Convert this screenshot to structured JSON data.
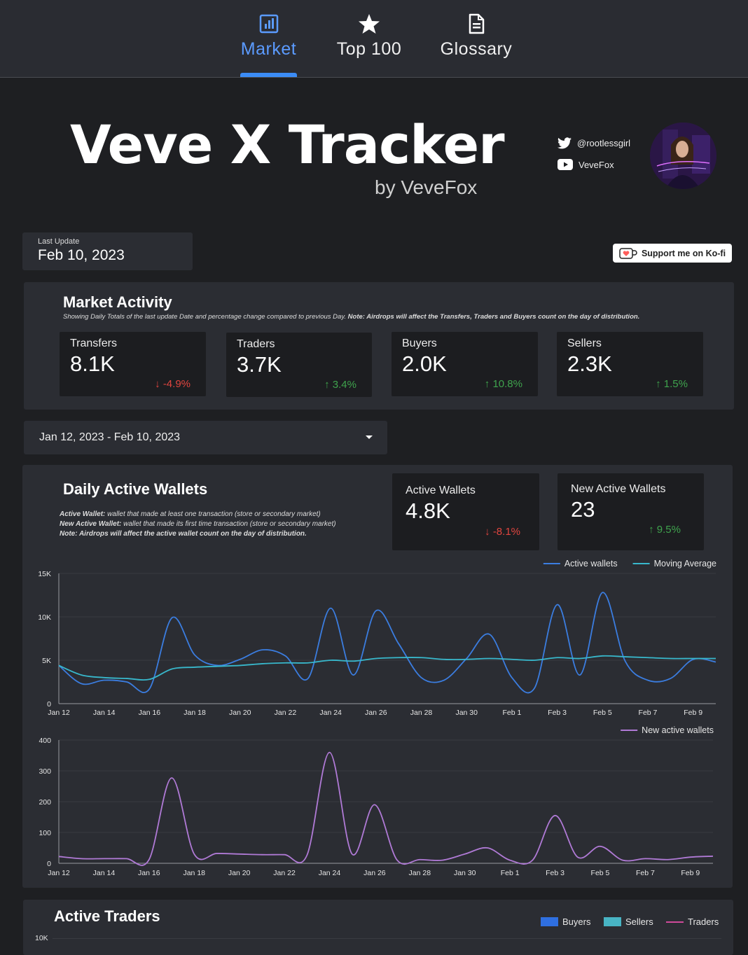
{
  "nav": {
    "tabs": [
      {
        "label": "Market"
      },
      {
        "label": "Top 100"
      },
      {
        "label": "Glossary"
      }
    ]
  },
  "header": {
    "title": "Veve X Tracker",
    "byline": "by VeveFox",
    "twitter": "@rootlessgirl",
    "youtube": "VeveFox"
  },
  "last_update": {
    "label": "Last Update",
    "value": "Feb 10, 2023"
  },
  "kofi": {
    "label": "Support me on Ko-fi"
  },
  "market_activity": {
    "title": "Market Activity",
    "subtitle": "Showing Daily Totals of the last update Date and percentage change compared to previous Day.",
    "note": "Note: Airdrops will affect the Transfers, Traders and Buyers count on the day of distribution.",
    "cards": [
      {
        "label": "Transfers",
        "value": "8.1K",
        "delta": "-4.9%",
        "trend": "down"
      },
      {
        "label": "Traders",
        "value": "3.7K",
        "delta": "3.4%",
        "trend": "up"
      },
      {
        "label": "Buyers",
        "value": "2.0K",
        "delta": "10.8%",
        "trend": "up"
      },
      {
        "label": "Sellers",
        "value": "2.3K",
        "delta": "1.5%",
        "trend": "up"
      }
    ]
  },
  "date_range": {
    "value": "Jan 12, 2023 - Feb 10, 2023"
  },
  "daily_active_wallets": {
    "title": "Daily Active Wallets",
    "def1_term": "Active Wallet:",
    "def1_text": " wallet that made at least one transaction (store or secondary market)",
    "def2_term": "New Active Wallet:",
    "def2_text": " wallet that made its first time transaction (store or secondary market)",
    "note": "Note: Airdrops will affect the active wallet count on the day of distribution.",
    "cards": [
      {
        "label": "Active Wallets",
        "value": "4.8K",
        "delta": "-8.1%",
        "trend": "down"
      },
      {
        "label": "New Active Wallets",
        "value": "23",
        "delta": "9.5%",
        "trend": "up"
      }
    ]
  },
  "active_traders": {
    "title": "Active Traders",
    "legend": [
      "Buyers",
      "Sellers",
      "Traders"
    ],
    "y_top_tick": "10K"
  },
  "colors": {
    "accent": "#3b8cf6",
    "active": "#3b7de0",
    "moving": "#38b8cc",
    "new": "#b07ad6",
    "buyers": "#2f6fe0",
    "sellers": "#48b4c4",
    "traders": "#d04a9a"
  },
  "chart_data": [
    {
      "type": "line",
      "x": [
        "Jan 12",
        "Jan 13",
        "Jan 14",
        "Jan 15",
        "Jan 16",
        "Jan 17",
        "Jan 18",
        "Jan 19",
        "Jan 20",
        "Jan 21",
        "Jan 22",
        "Jan 23",
        "Jan 24",
        "Jan 25",
        "Jan 26",
        "Jan 27",
        "Jan 28",
        "Jan 29",
        "Jan 30",
        "Jan 31",
        "Feb 1",
        "Feb 2",
        "Feb 3",
        "Feb 4",
        "Feb 5",
        "Feb 6",
        "Feb 7",
        "Feb 8",
        "Feb 9",
        "Feb 10"
      ],
      "x_ticks": [
        "Jan 12",
        "Jan 14",
        "Jan 16",
        "Jan 18",
        "Jan 20",
        "Jan 22",
        "Jan 24",
        "Jan 26",
        "Jan 28",
        "Jan 30",
        "Feb 1",
        "Feb 3",
        "Feb 5",
        "Feb 7",
        "Feb 9"
      ],
      "y_ticks": [
        "0",
        "5K",
        "10K",
        "15K"
      ],
      "ylim": [
        0,
        15000
      ],
      "legend_position": "top-right",
      "series": [
        {
          "name": "Active wallets",
          "values": [
            4400,
            2300,
            2700,
            2500,
            1700,
            9900,
            5600,
            4400,
            5100,
            6200,
            5500,
            2900,
            11000,
            3300,
            10700,
            6900,
            3000,
            2700,
            5200,
            8000,
            3000,
            1800,
            11400,
            3300,
            12800,
            4900,
            2700,
            2900,
            5100,
            4800
          ]
        },
        {
          "name": "Moving Average",
          "values": [
            4400,
            3300,
            3000,
            2900,
            2800,
            4000,
            4200,
            4300,
            4400,
            4600,
            4700,
            4700,
            5000,
            4900,
            5200,
            5300,
            5300,
            5100,
            5100,
            5200,
            5100,
            5000,
            5300,
            5200,
            5500,
            5400,
            5300,
            5200,
            5200,
            5200
          ]
        }
      ]
    },
    {
      "type": "line",
      "x": [
        "Jan 12",
        "Jan 13",
        "Jan 14",
        "Jan 15",
        "Jan 16",
        "Jan 17",
        "Jan 18",
        "Jan 19",
        "Jan 20",
        "Jan 21",
        "Jan 22",
        "Jan 23",
        "Jan 24",
        "Jan 25",
        "Jan 26",
        "Jan 27",
        "Jan 28",
        "Jan 29",
        "Jan 30",
        "Jan 31",
        "Feb 1",
        "Feb 2",
        "Feb 3",
        "Feb 4",
        "Feb 5",
        "Feb 6",
        "Feb 7",
        "Feb 8",
        "Feb 9",
        "Feb 10"
      ],
      "x_ticks": [
        "Jan 12",
        "Jan 14",
        "Jan 16",
        "Jan 18",
        "Jan 20",
        "Jan 22",
        "Jan 24",
        "Jan 26",
        "Jan 28",
        "Jan 30",
        "Feb 1",
        "Feb 3",
        "Feb 5",
        "Feb 7",
        "Feb 9"
      ],
      "y_ticks": [
        "0",
        "100",
        "200",
        "300",
        "400"
      ],
      "ylim": [
        0,
        400
      ],
      "legend_position": "top-right",
      "series": [
        {
          "name": "New active wallets",
          "values": [
            22,
            15,
            15,
            15,
            12,
            277,
            30,
            32,
            30,
            28,
            28,
            26,
            360,
            30,
            190,
            10,
            12,
            10,
            30,
            50,
            10,
            10,
            155,
            20,
            55,
            10,
            15,
            12,
            20,
            23
          ]
        }
      ]
    }
  ]
}
